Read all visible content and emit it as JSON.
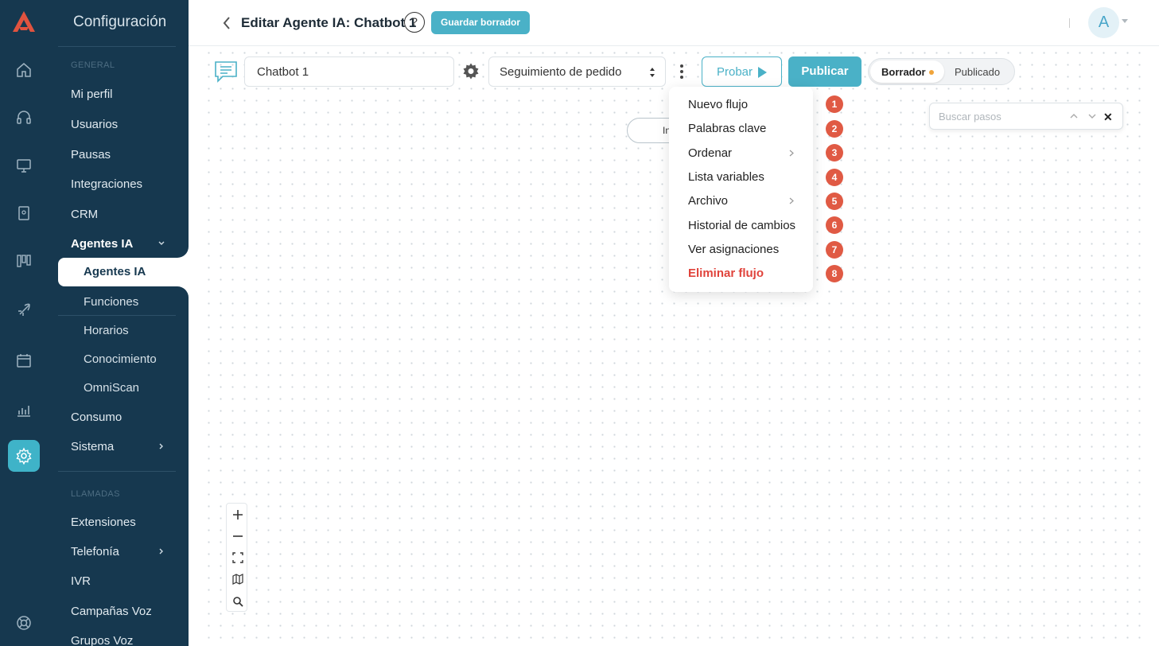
{
  "header": {
    "title": "Editar Agente IA: Chatbot 1",
    "help_label": "?",
    "save_draft_label": "Guardar borrador",
    "avatar_initial": "A"
  },
  "nav": {
    "title": "Configuración",
    "section_general": "GENERAL",
    "items_general": [
      "Mi perfil",
      "Usuarios",
      "Pausas",
      "Integraciones",
      "CRM"
    ],
    "group_ai": "Agentes IA",
    "ai_selected": "Agentes IA",
    "ai_subitems": [
      "Funciones",
      "Horarios",
      "Conocimiento",
      "OmniScan"
    ],
    "items_after": [
      "Consumo",
      "Sistema"
    ],
    "section_calls": "LLAMADAS",
    "items_calls": [
      "Extensiones",
      "Telefonía",
      "IVR",
      "Campañas Voz",
      "Grupos Voz"
    ]
  },
  "toolbar": {
    "bot_name": "Chatbot 1",
    "flow_selected": "Seguimiento de pedido",
    "test_label": "Probar",
    "publish_label": "Publicar",
    "status_draft": "Borrador",
    "status_published": "Publicado",
    "status_draft_color": "#f0a43a"
  },
  "search": {
    "placeholder": "Buscar pasos"
  },
  "canvas": {
    "start_node_label": "In"
  },
  "menu": {
    "items": [
      {
        "label": "Nuevo flujo",
        "badge": "1"
      },
      {
        "label": "Palabras clave",
        "badge": "2"
      },
      {
        "label": "Ordenar",
        "badge": "3"
      },
      {
        "label": "Lista variables",
        "badge": "4"
      },
      {
        "label": "Archivo",
        "badge": "5"
      },
      {
        "label": "Historial de cambios",
        "badge": "6"
      },
      {
        "label": "Ver asignaciones",
        "badge": "7"
      },
      {
        "label": "Eliminar flujo",
        "badge": "8"
      }
    ]
  },
  "colors": {
    "sidebar_bg": "#16384f",
    "accent": "#4ab1c7",
    "danger": "#e0433b",
    "badge": "#e05a44",
    "brand": "#e0533f"
  }
}
